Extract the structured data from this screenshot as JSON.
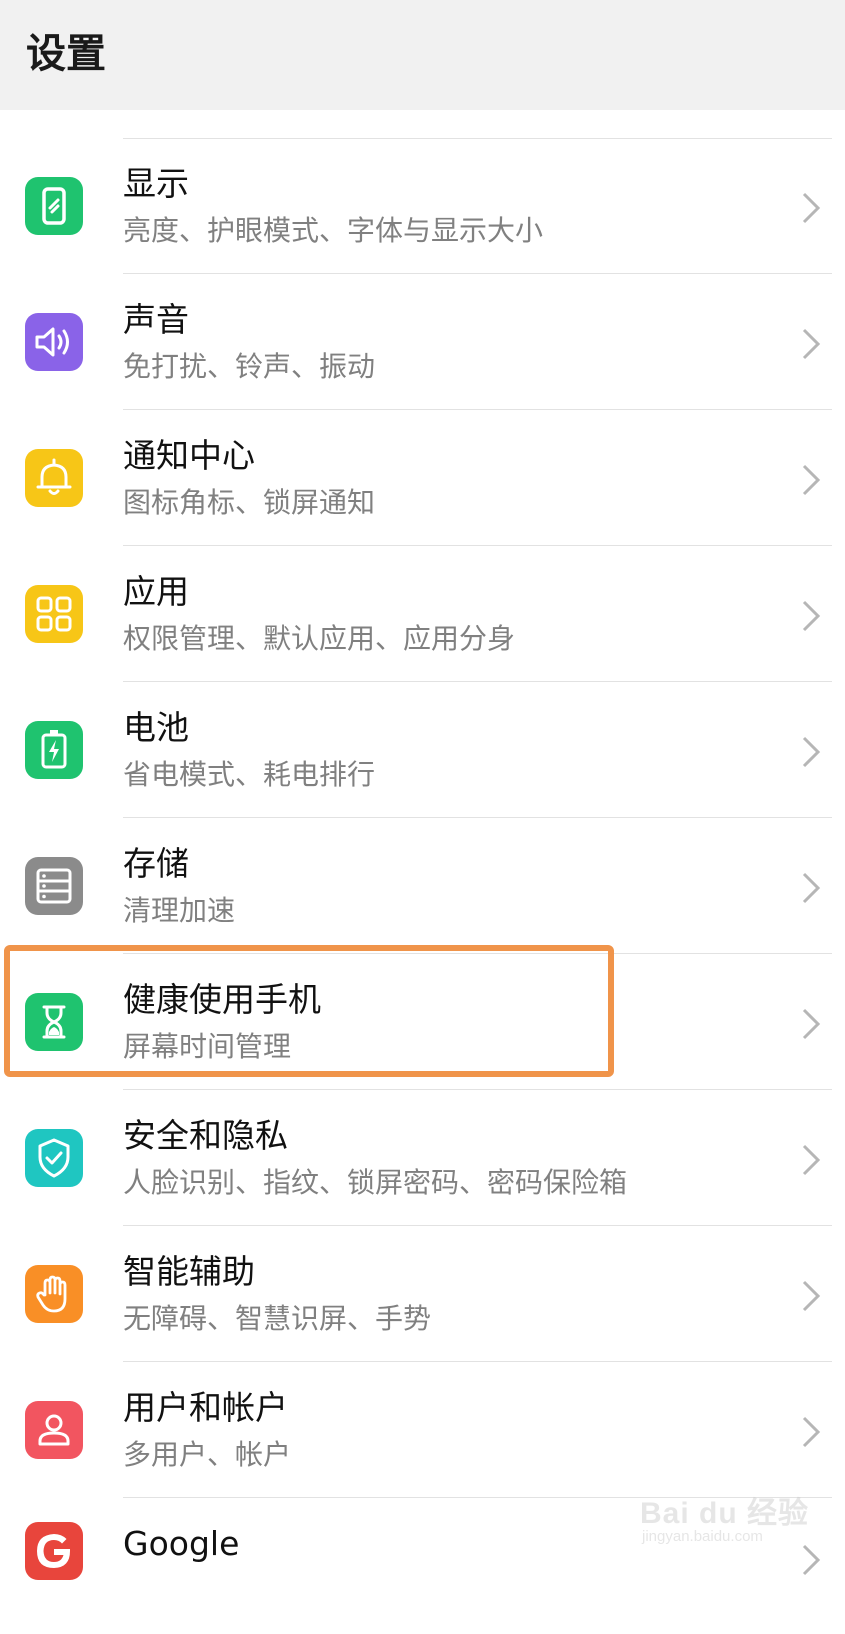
{
  "header": {
    "title": "设置"
  },
  "settings": {
    "items": [
      {
        "title": "显示",
        "subtitle": "亮度、护眼模式、字体与显示大小",
        "icon": "display-icon",
        "color": "#1fc36f"
      },
      {
        "title": "声音",
        "subtitle": "免打扰、铃声、振动",
        "icon": "speaker-icon",
        "color": "#8a63e8"
      },
      {
        "title": "通知中心",
        "subtitle": "图标角标、锁屏通知",
        "icon": "bell-icon",
        "color": "#f7c617"
      },
      {
        "title": "应用",
        "subtitle": "权限管理、默认应用、应用分身",
        "icon": "apps-grid-icon",
        "color": "#f7c617"
      },
      {
        "title": "电池",
        "subtitle": "省电模式、耗电排行",
        "icon": "battery-icon",
        "color": "#1fc36f"
      },
      {
        "title": "存储",
        "subtitle": "清理加速",
        "icon": "storage-icon",
        "color": "#8b8b8b"
      },
      {
        "title": "健康使用手机",
        "subtitle": "屏幕时间管理",
        "icon": "hourglass-icon",
        "color": "#1fc36f"
      },
      {
        "title": "安全和隐私",
        "subtitle": "人脸识别、指纹、锁屏密码、密码保险箱",
        "icon": "shield-icon",
        "color": "#1fc6c1"
      },
      {
        "title": "智能辅助",
        "subtitle": "无障碍、智慧识屏、手势",
        "icon": "hand-icon",
        "color": "#f98f26"
      },
      {
        "title": "用户和帐户",
        "subtitle": "多用户、帐户",
        "icon": "user-icon",
        "color": "#f25560"
      },
      {
        "title": "Google",
        "subtitle": "",
        "icon": "google-icon",
        "color": "#ffffff"
      }
    ]
  },
  "highlight_color": "#f0944a",
  "watermark": {
    "brand": "Bai du 经验",
    "url": "jingyan.baidu.com"
  }
}
